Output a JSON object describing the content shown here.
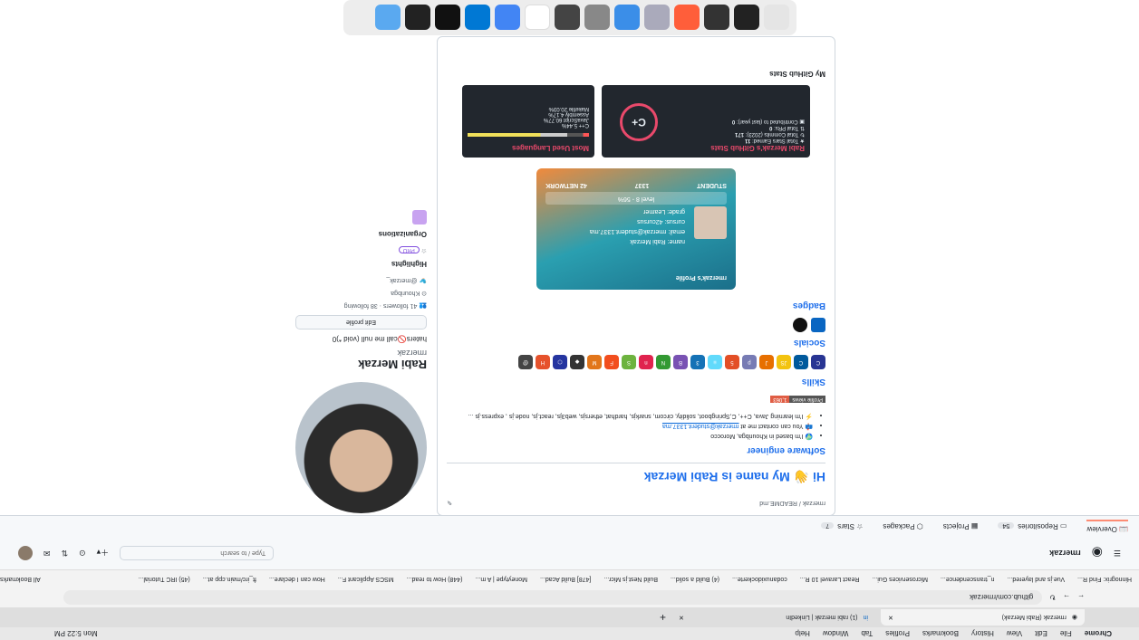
{
  "menubar": {
    "items": [
      "Chrome",
      "File",
      "Edit",
      "View",
      "History",
      "Bookmarks",
      "Profiles",
      "Tab",
      "Window",
      "Help"
    ],
    "clock": "Mon 5:22 PM"
  },
  "tabs": [
    {
      "label": "rmerzak (Rabi Merzak)"
    },
    {
      "label": "(1) rabi merzak | LinkedIn"
    }
  ],
  "address": "github.com/rmerzak",
  "bookmarks": [
    "Hinnogrix: Find R...",
    "Vue.js and layered...",
    "n_transcendence...",
    "Microservices Gui...",
    "React Laravel 10 R...",
    "codanuxidockerte...",
    "(4) Build a solid...",
    "Build Nest.js Micr...",
    "[478] Build Acad...",
    "Moneytype | A m...",
    "(448) How to read...",
    "MSCS Applicant F...",
    "How can I declare...",
    "ft_irc/main.cpp at...",
    "(45) IRC Tutorial...",
    "All Bookmarks"
  ],
  "header": {
    "user": "rmerzak",
    "search": "Type / to search"
  },
  "nav": {
    "overview": "Overview",
    "repositories": "Repositories",
    "repo_count": "54",
    "projects": "Projects",
    "packages": "Packages",
    "stars": "Stars",
    "stars_count": "7"
  },
  "profile": {
    "name": "Rabi Merzak",
    "username": "rmerzak",
    "bio": "haters🚫call me null (void *)0",
    "edit": "Edit profile",
    "followers": "41 followers · 38 following",
    "location": "Khouribga",
    "twitter": "@merzak_",
    "highlights": "Highlights",
    "pro": "PRO",
    "organizations": "Organizations"
  },
  "readme": {
    "path": "rmerzak / README.md",
    "title": "Hi 👋 My name is Rabi Merzak",
    "subtitle": "Software engineer",
    "bullets": [
      "🌍 I'm based in Khouribga, Morocco",
      "📫 You can contact me at",
      "⚡ I'm learning Java, C++, C,Springboot, solidity, circom, snarkjs, hardhat, ethersjs, web3js, react.js, node.js , express.js ..."
    ],
    "email": "rmerzak@student.1337.ma",
    "views_label": "Profile views",
    "views": "1,063",
    "skills_h": "Skills",
    "socials_h": "Socials",
    "badges_h": "Badges",
    "card": {
      "title": "rmerzak's Profile",
      "name": "Rabi Merzak",
      "email": "rmerzak@student.1337.ma",
      "cursus": "42cursus",
      "grade": "Learner",
      "level": "level 8 - 56%",
      "tag": "STUDENT",
      "network": "42 NETWORK",
      "school": "1337"
    },
    "stats_h": "My GitHub Stats",
    "langs": {
      "title": "Most Used Languages",
      "items": [
        "C++ 5.44%",
        "JavaScript 60.77%",
        "Assembly 4.17%",
        "Makefile 20.03%",
        "CSS 2.94%",
        "C 6.65%"
      ]
    },
    "stats": {
      "title": "Rabi Merzak's GitHub Stats",
      "stars": "Total Stars Earned:",
      "stars_v": "11",
      "commits": "Total Commits (2023):",
      "commits_v": "171",
      "prs": "Total PRs:",
      "prs_v": "0",
      "contrib": "Contributed to (last year):",
      "contrib_v": "0",
      "grade": "C+"
    }
  }
}
